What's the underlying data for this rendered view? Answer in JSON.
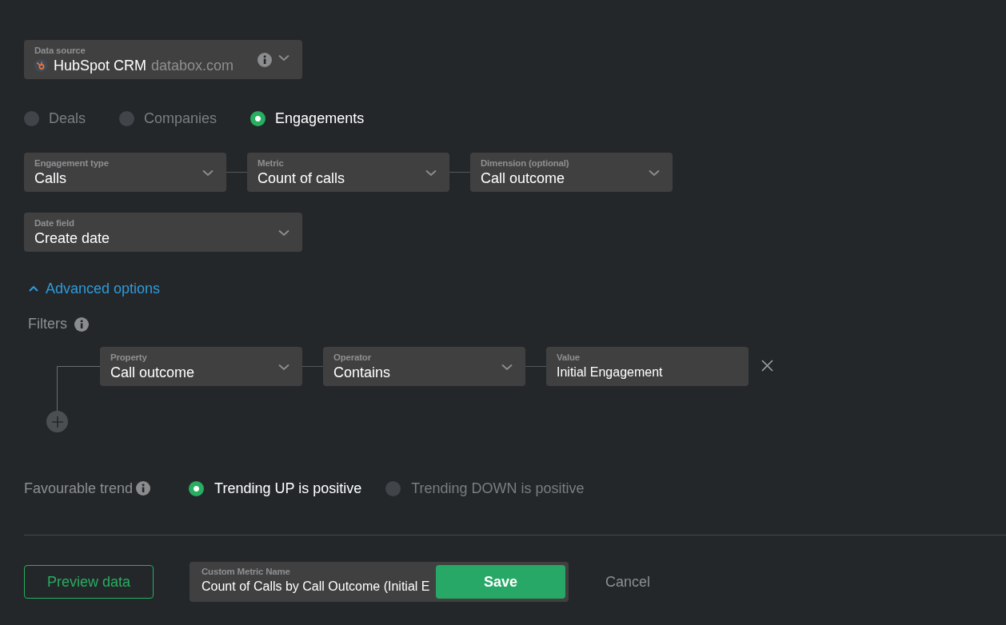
{
  "data_source": {
    "label": "Data source",
    "name": "HubSpot CRM",
    "account": "databox.com"
  },
  "entities": [
    {
      "label": "Deals",
      "selected": false
    },
    {
      "label": "Companies",
      "selected": false
    },
    {
      "label": "Engagements",
      "selected": true
    }
  ],
  "selects": [
    {
      "label": "Engagement type",
      "value": "Calls"
    },
    {
      "label": "Metric",
      "value": "Count of calls"
    },
    {
      "label": "Dimension (optional)",
      "value": "Call outcome"
    }
  ],
  "date_field": {
    "label": "Date field",
    "value": "Create date"
  },
  "advanced": {
    "label": "Advanced options",
    "expanded": true
  },
  "filters": {
    "label": "Filters",
    "rows": [
      {
        "fields": [
          {
            "kind": "select",
            "label": "Property",
            "value": "Call outcome"
          },
          {
            "kind": "select",
            "label": "Operator",
            "value": "Contains"
          },
          {
            "kind": "input",
            "label": "Value",
            "value": "Initial Engagement"
          }
        ]
      }
    ]
  },
  "trend": {
    "label": "Favourable trend",
    "options": [
      {
        "label": "Trending UP is positive",
        "selected": true
      },
      {
        "label": "Trending DOWN is positive",
        "selected": false
      }
    ]
  },
  "footer": {
    "preview": "Preview data",
    "name_field": {
      "label": "Custom Metric Name",
      "value": "Count of Calls by Call Outcome (Initial E"
    },
    "save": "Save",
    "cancel": "Cancel"
  }
}
